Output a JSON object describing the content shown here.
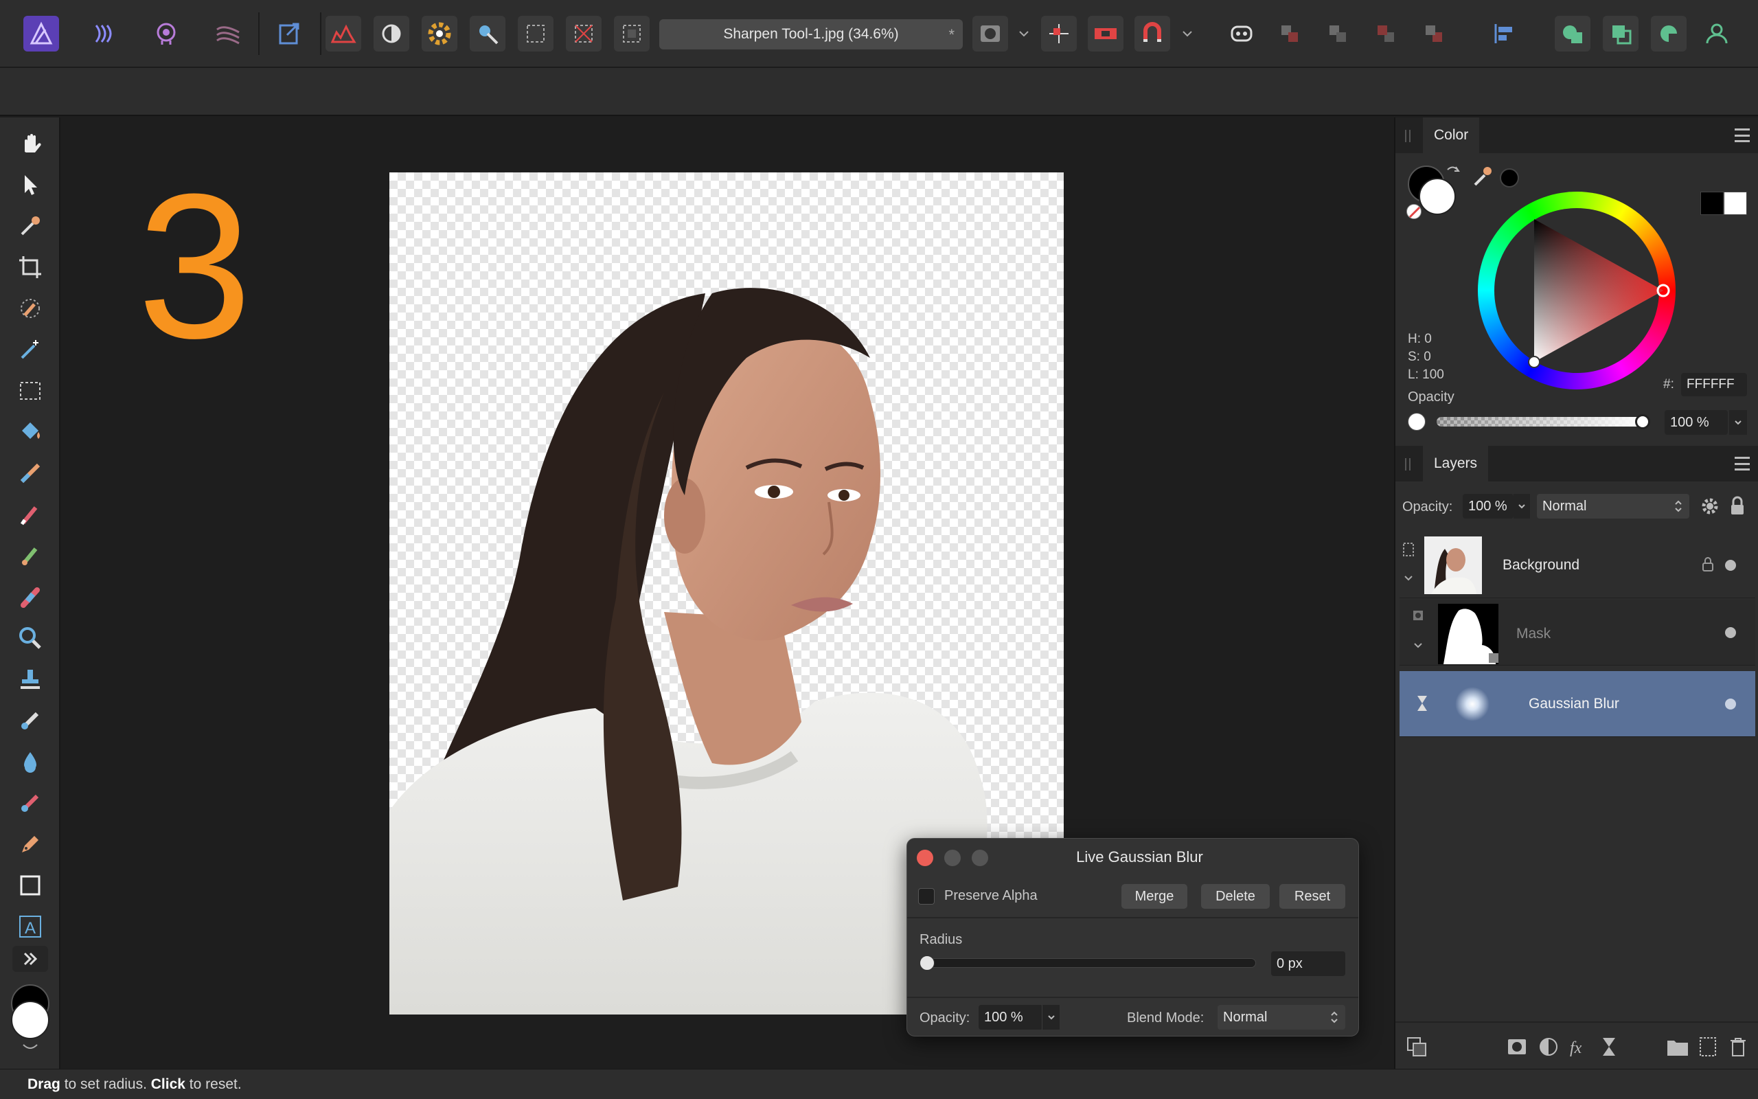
{
  "toolbar": {
    "document_title": "Sharpen Tool-1.jpg (34.6%)",
    "modified_marker": "*",
    "icons": [
      "affinity-photo-logo-icon",
      "develop-persona-icon",
      "liquify-persona-icon",
      "tone-mapping-persona-icon",
      "export-persona-icon",
      "levels-icon",
      "auto-contrast-icon",
      "color-wheel-icon",
      "white-balance-icon",
      "selection-icon",
      "deselect-icon",
      "invert-selection-icon",
      "mask-mode-icon",
      "snapping-icon",
      "magnet-icon",
      "assistant-icon",
      "arrange-icons",
      "align-icon",
      "boolean-icons",
      "user-icon"
    ]
  },
  "canvas": {
    "step_number": "3"
  },
  "dialog": {
    "title": "Live Gaussian Blur",
    "preserve_alpha_label": "Preserve Alpha",
    "merge_label": "Merge",
    "delete_label": "Delete",
    "reset_label": "Reset",
    "radius_label": "Radius",
    "radius_value": "0 px",
    "opacity_label": "Opacity:",
    "opacity_value": "100 %",
    "blend_mode_label": "Blend Mode:",
    "blend_mode_value": "Normal"
  },
  "color_panel": {
    "tab_label": "Color",
    "h_label": "H: 0",
    "s_label": "S: 0",
    "l_label": "L: 100",
    "opacity_label": "Opacity",
    "hex_label": "#:",
    "hex_value": "FFFFFF",
    "opacity_value": "100 %",
    "opacity_fraction": 1.0
  },
  "layers_panel": {
    "tab_label": "Layers",
    "opacity_label": "Opacity:",
    "opacity_value": "100 %",
    "blend_mode": "Normal",
    "layers": [
      {
        "name": "Background"
      },
      {
        "name": "Mask"
      },
      {
        "name": "Gaussian Blur"
      }
    ]
  },
  "status": {
    "drag_word": "Drag",
    "drag_text": " to set radius. ",
    "click_word": "Click",
    "click_text": " to reset."
  },
  "colors": {
    "accent_orange": "#f7931e",
    "selected_layer": "#5a7198",
    "panel_bg": "#2d2d2d"
  }
}
